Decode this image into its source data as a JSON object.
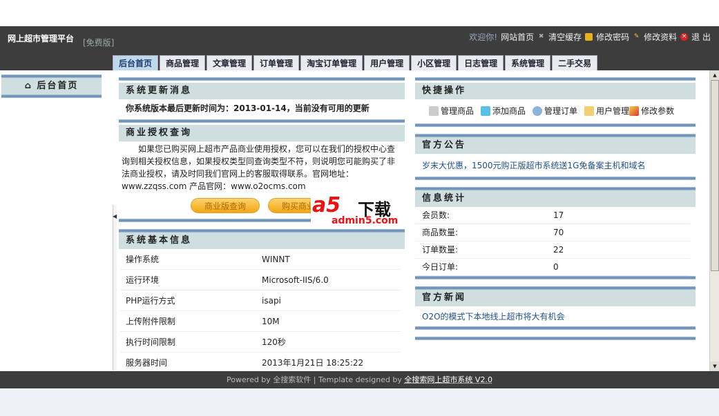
{
  "header": {
    "brand": "网上超市管理平台",
    "edition": "[免费版]",
    "links": {
      "welcome": "欢迎你!",
      "site_home": "网站首页",
      "clear_cache": "清空缓存",
      "change_password": "修改密码",
      "edit_profile": "修改资料",
      "logout": "退 出"
    }
  },
  "tabs": [
    "后台首页",
    "商品管理",
    "文章管理",
    "订单管理",
    "淘宝订单管理",
    "用户管理",
    "小区管理",
    "日志管理",
    "系统管理",
    "二手交易"
  ],
  "sidebar": {
    "title": "后台首页"
  },
  "update": {
    "title": "系统更新消息",
    "text": "你系统版本最后更新时间为：2013-01-14，当前没有可用的更新"
  },
  "license": {
    "title": "商业授权查询",
    "text": "如果您已购买网上超市产品商业使用授权，您可以在我们的授权中心查询到相关授权信息，如果授权类型同查询类型不符，则说明您可能购买了非法商业授权，请及时同我们官网上的客服取得联系。官网地址：www.zzqss.com 产品官网：www.o2ocms.com",
    "btn_query": "商业版查询",
    "btn_buy": "购买商业版"
  },
  "sysinfo": {
    "title": "系统基本信息",
    "rows": [
      {
        "k": "操作系统",
        "v": "WINNT"
      },
      {
        "k": "运行环境",
        "v": "Microsoft-IIS/6.0"
      },
      {
        "k": "PHP运行方式",
        "v": "isapi"
      },
      {
        "k": "上传附件限制",
        "v": "10M"
      },
      {
        "k": "执行时间限制",
        "v": "120秒"
      },
      {
        "k": "服务器时间",
        "v": "2013年1月21日 18:25:22"
      }
    ]
  },
  "quick": {
    "title": "快捷操作",
    "items": [
      "管理商品",
      "添加商品",
      "管理订单",
      "用户管理",
      "修改参数"
    ]
  },
  "notice": {
    "title": "官方公告",
    "text": "岁末大优惠，1500元购正版超市系统送1G免备案主机和域名"
  },
  "stats": {
    "title": "信息统计",
    "rows": [
      {
        "k": "会员数:",
        "v": "17"
      },
      {
        "k": "商品数量:",
        "v": "70"
      },
      {
        "k": "订单数量:",
        "v": "22"
      },
      {
        "k": "今日订单:",
        "v": "0"
      }
    ]
  },
  "news": {
    "title": "官方新闻",
    "text": "O2O的模式下本地线上超市将大有机会"
  },
  "footer": {
    "text": "Powered by 全搜索软件 | Template designed by",
    "link": "全搜索网上超市系统 V2.0"
  },
  "watermark": {
    "logo": "a5下载",
    "domain": "admin5.com"
  }
}
